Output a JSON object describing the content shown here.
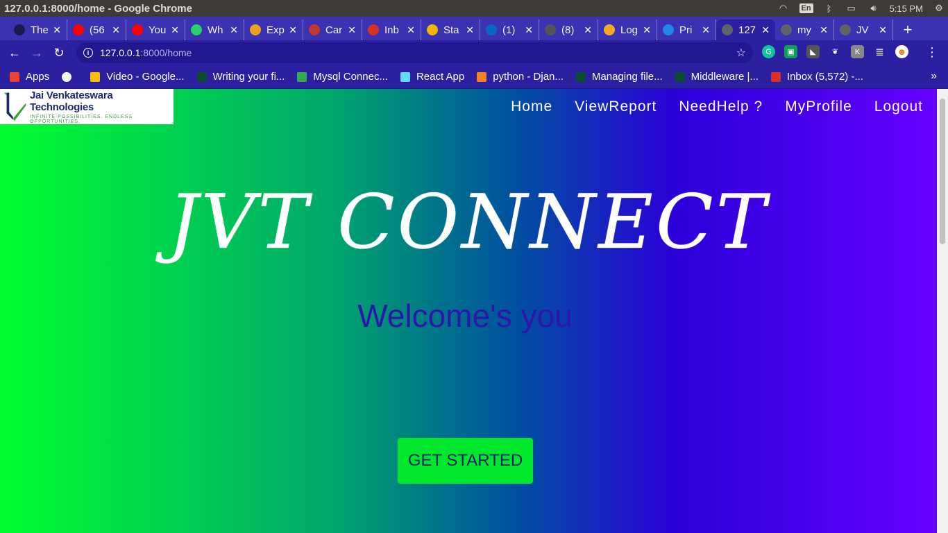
{
  "os": {
    "window_title": "127.0.0.1:8000/home - Google Chrome",
    "lang": "En",
    "time": "5:15 PM"
  },
  "tabs": [
    {
      "title": "The",
      "fav_color": "#1b1b4a",
      "icon": "loading-icon"
    },
    {
      "title": "(56",
      "fav_color": "#ff0000",
      "icon": "youtube-icon"
    },
    {
      "title": "You",
      "fav_color": "#ff0000",
      "icon": "youtube-music-icon"
    },
    {
      "title": "Wh",
      "fav_color": "#25d366",
      "icon": "whatsapp-icon"
    },
    {
      "title": "Exp",
      "fav_color": "#e8a317",
      "icon": "explore-icon"
    },
    {
      "title": "Car",
      "fav_color": "#c0392b",
      "icon": "c-logo-icon"
    },
    {
      "title": "Inb",
      "fav_color": "#d93025",
      "icon": "gmail-icon"
    },
    {
      "title": "Sta",
      "fav_color": "#f4b400",
      "icon": "hand-icon"
    },
    {
      "title": "(1)",
      "fav_color": "#0a66c2",
      "icon": "linkedin-icon"
    },
    {
      "title": "(8)",
      "fav_color": "#555555",
      "icon": "runner-icon"
    },
    {
      "title": "Log",
      "fav_color": "#f5a623",
      "icon": "shine-icon"
    },
    {
      "title": "Pri",
      "fav_color": "#1e88e5",
      "icon": "play-icon"
    },
    {
      "title": "127",
      "fav_color": "#5f6368",
      "icon": "globe-icon",
      "active": true
    },
    {
      "title": "my",
      "fav_color": "#5f6368",
      "icon": "globe-icon"
    },
    {
      "title": "JV",
      "fav_color": "#5f6368",
      "icon": "globe-icon"
    }
  ],
  "toolbar": {
    "url_host": "127.0.0.1",
    "url_path": ":8000/home"
  },
  "bookmarks": [
    {
      "label": "Apps",
      "color": "#e94235",
      "icon": "apps-grid-icon"
    },
    {
      "label": "",
      "color": "#ffffff",
      "icon": "globe-icon"
    },
    {
      "label": "Video - Google...",
      "color": "#fbbc04",
      "icon": "google-pinwheel-icon"
    },
    {
      "label": "Writing your fi...",
      "color": "#0c4b33",
      "icon": "django-icon"
    },
    {
      "label": "Mysql Connec...",
      "color": "#34a853",
      "icon": "loading-ring-icon"
    },
    {
      "label": "React App",
      "color": "#61dafb",
      "icon": "react-icon"
    },
    {
      "label": "python - Djan...",
      "color": "#f48024",
      "icon": "stackoverflow-icon"
    },
    {
      "label": "Managing file...",
      "color": "#0c4b33",
      "icon": "django-icon"
    },
    {
      "label": "Middleware |...",
      "color": "#0c4b33",
      "icon": "django-icon"
    },
    {
      "label": "Inbox (5,572) -...",
      "color": "#d93025",
      "icon": "gmail-icon"
    }
  ],
  "page": {
    "logo_name": "Jai Venkateswara Technologies",
    "logo_tagline": "INFINITE POSSIBILITIES. ENDLESS OPPORTUNITIES.",
    "nav": [
      "Home",
      "ViewReport",
      "NeedHelp ?",
      "MyProfile",
      "Logout"
    ],
    "title": "JVT CONNECT",
    "subtitle": "Welcome's you",
    "cta": "GET STARTED"
  }
}
